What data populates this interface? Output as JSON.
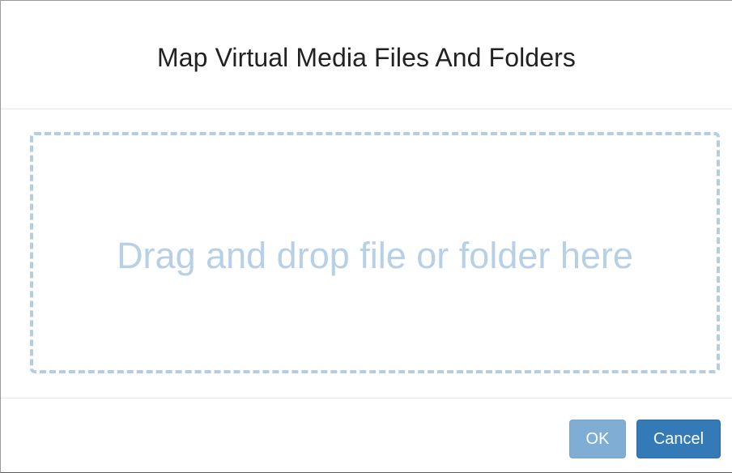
{
  "dialog": {
    "title": "Map Virtual Media Files And Folders",
    "drop_zone": {
      "text": "Drag and drop file or folder here"
    },
    "footer": {
      "ok_label": "OK",
      "ok_state": "disabled",
      "cancel_label": "Cancel"
    }
  },
  "colors": {
    "primary_button": "#337ab7",
    "disabled_button": "#7fadd4",
    "drop_zone_border": "#b3cde3",
    "drop_zone_text": "#b7d0e6"
  }
}
